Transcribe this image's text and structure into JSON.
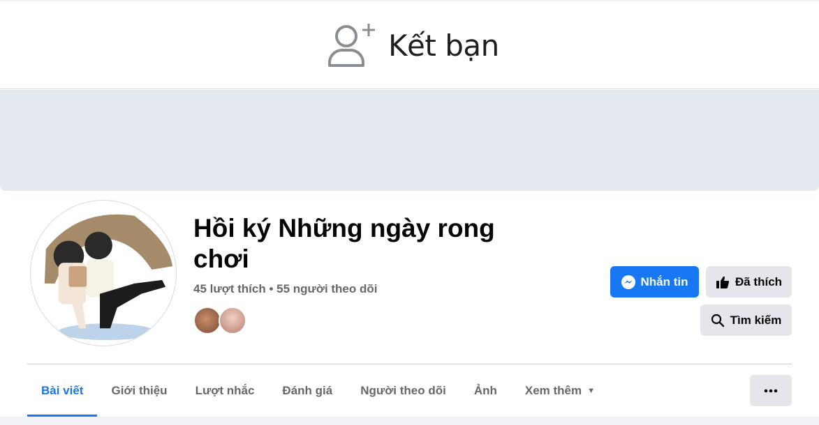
{
  "top_action": {
    "label": "Kết bạn",
    "icon": "add-friend-icon"
  },
  "page": {
    "name": "Hồi ký Những ngày rong chơi",
    "stats": "45 lượt thích • 55 người theo dõi"
  },
  "actions": {
    "message_label": "Nhắn tin",
    "liked_label": "Đã thích",
    "search_label": "Tìm kiếm"
  },
  "tabs": [
    {
      "label": "Bài viết",
      "active": true
    },
    {
      "label": "Giới thiệu"
    },
    {
      "label": "Lượt nhắc"
    },
    {
      "label": "Đánh giá"
    },
    {
      "label": "Người theo dõi"
    },
    {
      "label": "Ảnh"
    },
    {
      "label": "Xem thêm"
    }
  ],
  "colors": {
    "accent": "#1877f2",
    "button_gray": "#e4e6eb",
    "cover": "#e4e8ef",
    "muted_text": "#65676b"
  }
}
